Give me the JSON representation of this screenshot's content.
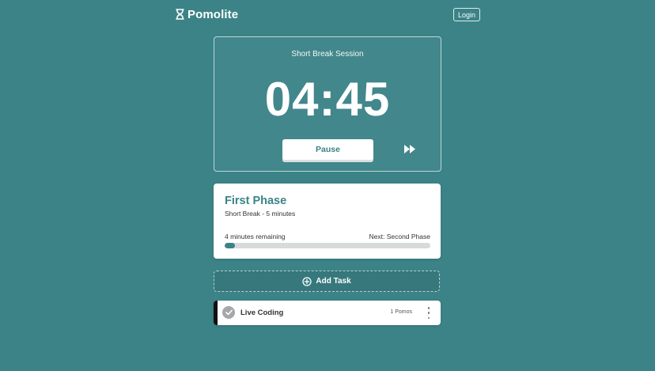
{
  "app": {
    "name": "Pomolite",
    "logo_icon": "hourglass-icon",
    "login_label": "Login"
  },
  "timer": {
    "session_label": "Short Break Session",
    "time": "04:45",
    "pause_label": "Pause",
    "skip_icon": "fast-forward-icon"
  },
  "phase": {
    "title": "First Phase",
    "subtitle": "Short Break - 5 minutes",
    "remaining": "4 minutes remaining",
    "next": "Next: Second Phase",
    "progress_fraction": 0.05
  },
  "add_task": {
    "label": "Add Task",
    "icon": "plus-circle-icon"
  },
  "tasks": [
    {
      "title": "Live Coding",
      "pomos": "1 Pomos",
      "check_icon": "check-circle-icon",
      "menu_icon": "more-vertical-icon"
    }
  ],
  "colors": {
    "background": "#3b8387",
    "accent": "#3b8387",
    "card": "#ffffff",
    "progress_track": "#d6dadb",
    "task_marker": "#111111"
  }
}
